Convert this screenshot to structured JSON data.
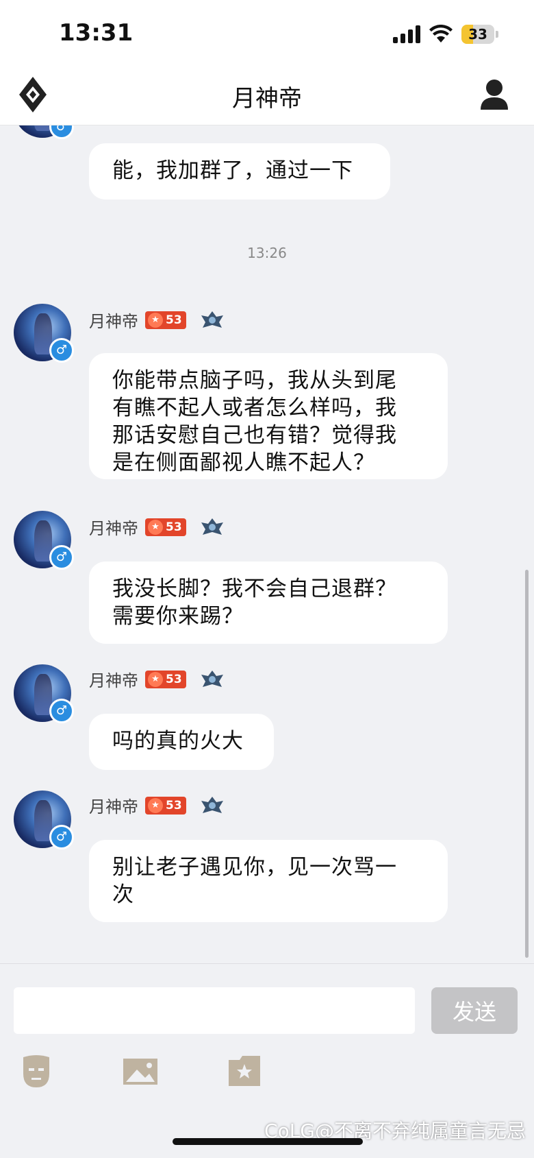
{
  "status_bar": {
    "time": "13:31",
    "battery": "33",
    "signal_icon": "cellular-signal-icon",
    "wifi_icon": "wifi-icon"
  },
  "header": {
    "title": "月神帝",
    "logo_icon": "diamond-logo-icon",
    "profile_icon": "user-profile-icon"
  },
  "chat": {
    "partial_message": "能，我加群了，通过一下",
    "timestamp": "13:26",
    "messages": [
      {
        "sender": "月神帝",
        "level": "53",
        "lines": [
          "你能带点脑子吗，我从头到尾",
          "有瞧不起人或者怎么样吗，我",
          "那话安慰自己也有错？觉得我",
          "是在侧面鄙视人瞧不起人？"
        ]
      },
      {
        "sender": "月神帝",
        "level": "53",
        "lines": [
          "我没长脚？我不会自己退群？",
          "需要你来踢？"
        ]
      },
      {
        "sender": "月神帝",
        "level": "53",
        "lines": [
          "吗的真的火大"
        ]
      },
      {
        "sender": "月神帝",
        "level": "53",
        "lines": [
          "别让老子遇见你，见一次骂一",
          "次"
        ]
      }
    ],
    "gender_symbol": "♂"
  },
  "composer": {
    "input_value": "",
    "send_label": "发送",
    "tools": [
      "emoji-icon",
      "image-icon",
      "sticker-icon"
    ]
  },
  "watermark": "CoLG@不离不弃纯属童言无忌",
  "colors": {
    "background": "#f0f1f4",
    "bubble": "#ffffff",
    "level_badge": "#e2452a",
    "gender_badge": "#2a8de0",
    "send_button": "#c4c4c6"
  }
}
